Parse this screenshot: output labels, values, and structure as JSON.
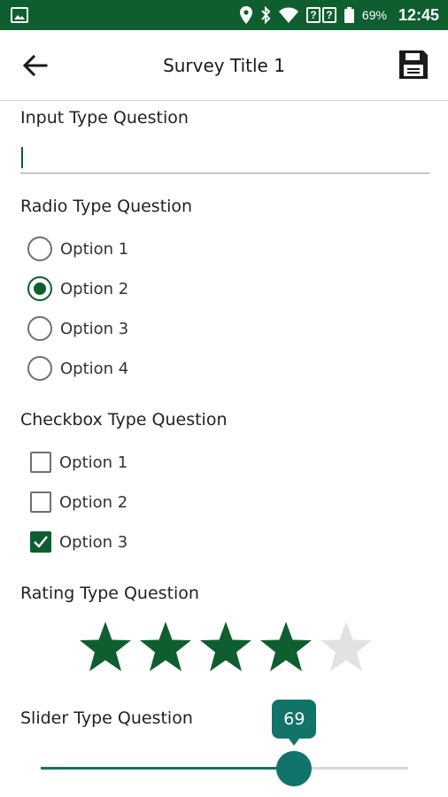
{
  "status_bar": {
    "battery": "69%",
    "time": "12:45",
    "icons": [
      "image-icon",
      "location-icon",
      "bluetooth-icon",
      "wifi-icon",
      "unknown-sim-icon",
      "battery-icon"
    ],
    "unknown_glyph": "?"
  },
  "app_bar": {
    "title": "Survey Title 1",
    "back_icon": "arrow-back-icon",
    "save_icon": "floppy-disk-icon"
  },
  "questions": {
    "input": {
      "title": "Input Type Question",
      "value": ""
    },
    "radio": {
      "title": "Radio Type Question",
      "options": [
        "Option 1",
        "Option 2",
        "Option 3",
        "Option 4"
      ],
      "selected": "Option 2"
    },
    "checkbox": {
      "title": "Checkbox Type Question",
      "options": [
        "Option 1",
        "Option 2",
        "Option 3"
      ],
      "checked": [
        "Option 3"
      ]
    },
    "rating": {
      "title": "Rating Type Question",
      "value": 4,
      "max": 5
    },
    "slider": {
      "title": "Slider Type Question",
      "value": 69,
      "min": 0,
      "max": 100,
      "value_label": "69"
    }
  },
  "colors": {
    "primary": "#0f5e2f",
    "slider": "#11736a",
    "star_active": "#0f5e2f",
    "star_inactive": "#e2e2e2"
  }
}
